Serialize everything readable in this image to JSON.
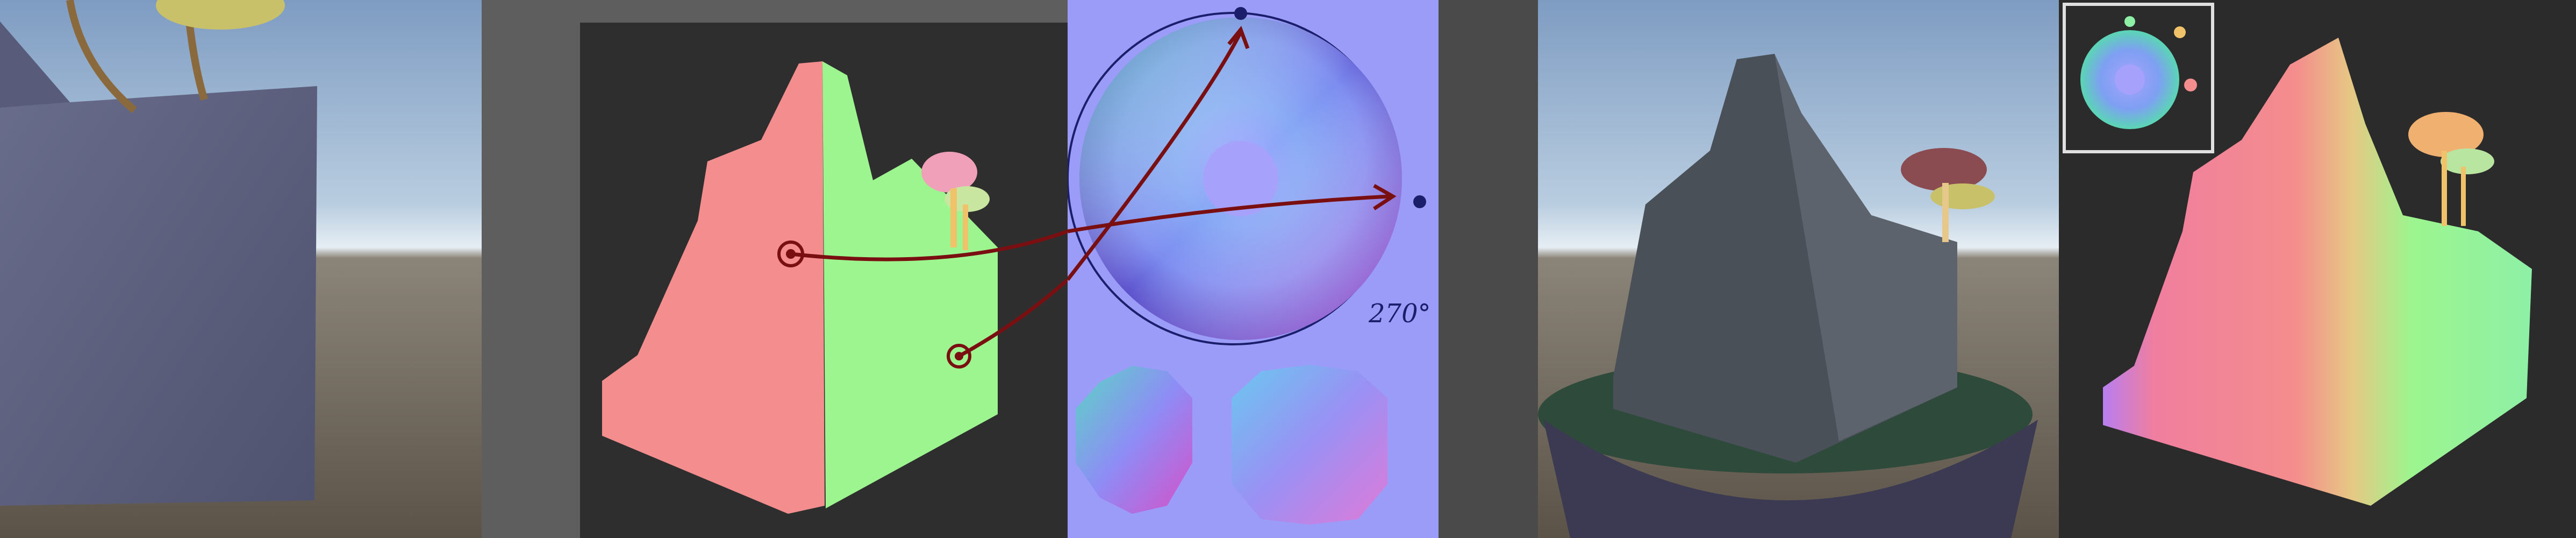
{
  "panels": {
    "scene_view_left": {
      "sky_top": "#8fa9c8",
      "sky_horizon": "#e8f0f6",
      "ground": "#6e6558"
    },
    "normal_painted_model": {
      "backdrop": "#2e2e2e",
      "surround": "#5e5e5e",
      "face_left": "#f48d8d",
      "face_right": "#9cf58e"
    },
    "normal_sphere_reference": {
      "background": "#9a9cf8",
      "annotation": "270°",
      "arrow_color": "#7a0f12"
    },
    "scene_view_right": {
      "sky_top": "#8fa9c8",
      "sky_horizon": "#e8f0f6",
      "ground": "#6e6558"
    },
    "normal_painted_model_final": {
      "backdrop": "#2b2b2b",
      "inset_border": "#e0e0e0"
    }
  }
}
